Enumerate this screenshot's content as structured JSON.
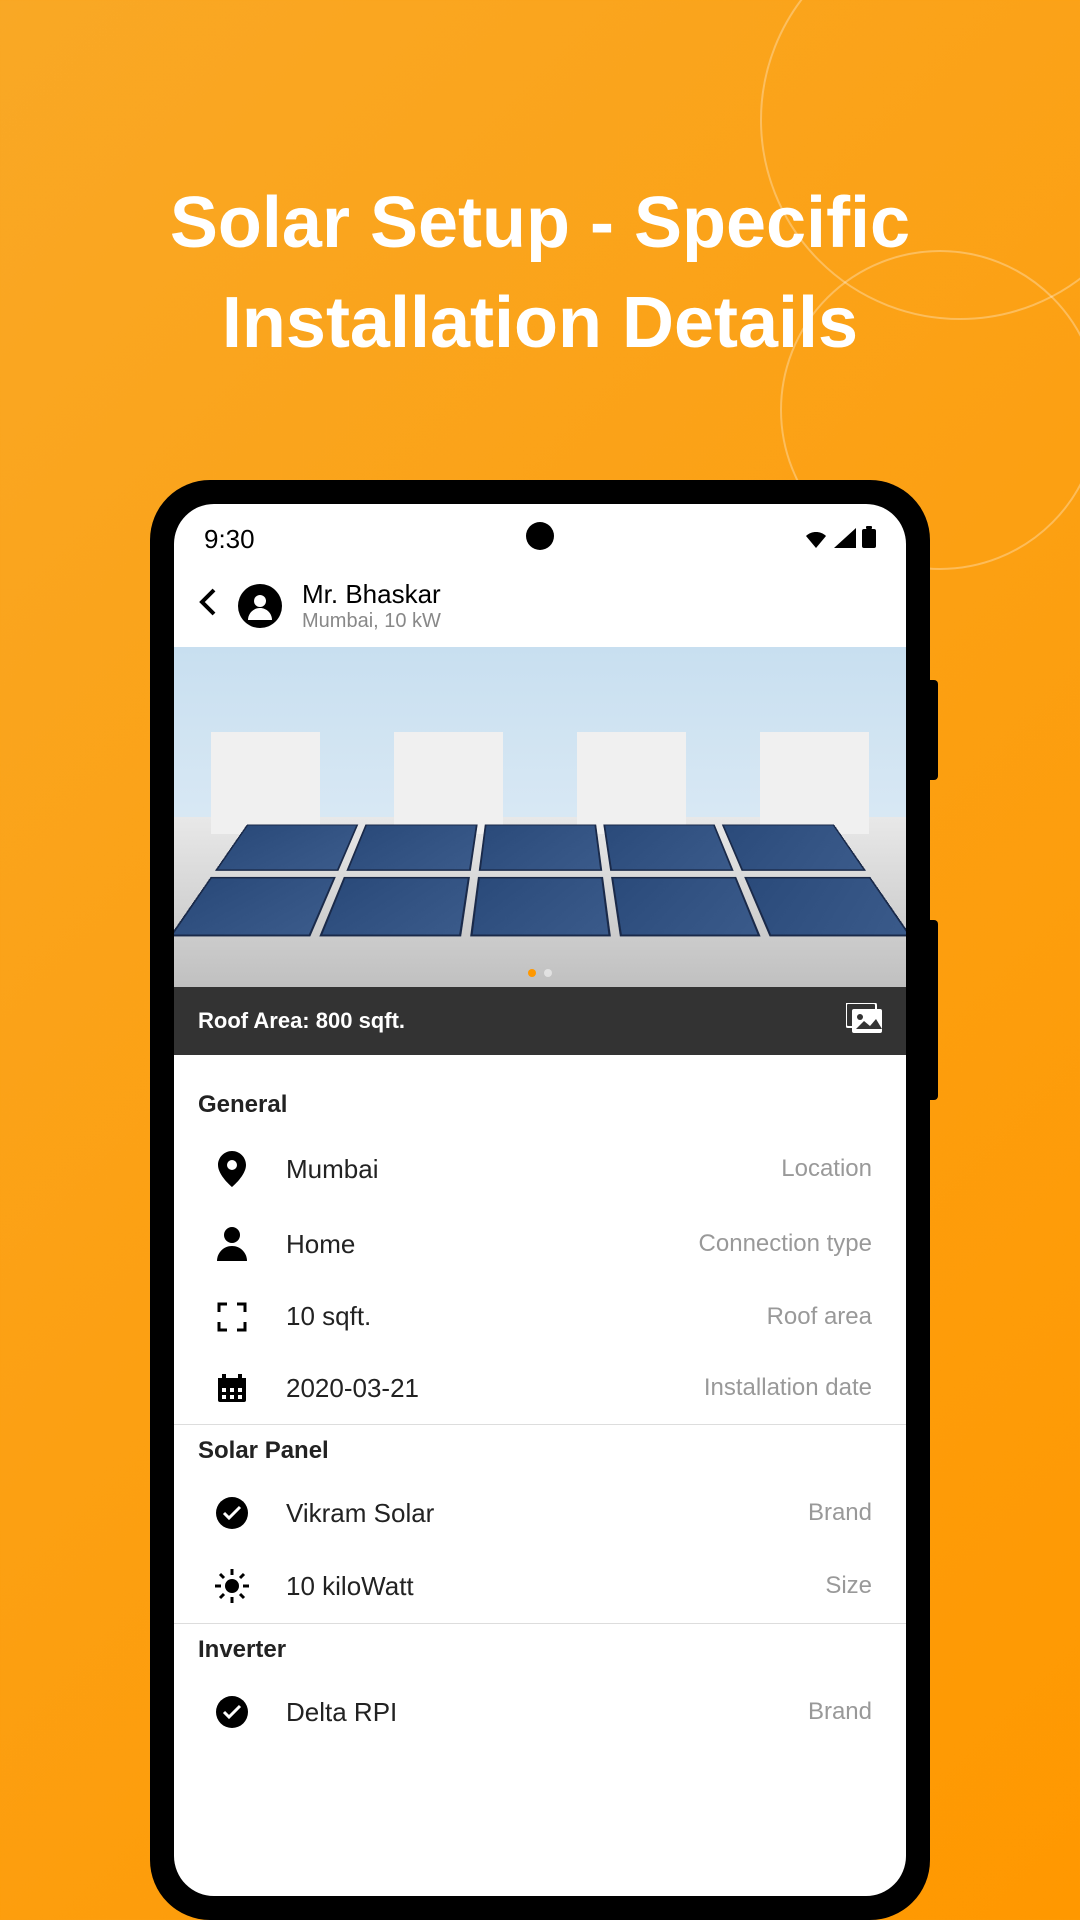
{
  "marketing": {
    "title_line1": "Solar Setup - Specific",
    "title_line2": "Installation Details"
  },
  "status_bar": {
    "time": "9:30"
  },
  "header": {
    "name": "Mr. Bhaskar",
    "subtitle": "Mumbai, 10 kW"
  },
  "info_strip": {
    "text": "Roof Area: 800 sqft."
  },
  "sections": {
    "general": {
      "title": "General",
      "rows": [
        {
          "value": "Mumbai",
          "label": "Location",
          "icon": "location"
        },
        {
          "value": "Home",
          "label": "Connection type",
          "icon": "person"
        },
        {
          "value": "10 sqft.",
          "label": "Roof area",
          "icon": "expand"
        },
        {
          "value": "2020-03-21",
          "label": "Installation date",
          "icon": "calendar"
        }
      ]
    },
    "solar_panel": {
      "title": "Solar Panel",
      "rows": [
        {
          "value": "Vikram Solar",
          "label": "Brand",
          "icon": "check"
        },
        {
          "value": "10 kiloWatt",
          "label": "Size",
          "icon": "sun"
        }
      ]
    },
    "inverter": {
      "title": "Inverter",
      "rows": [
        {
          "value": "Delta RPI",
          "label": "Brand",
          "icon": "check"
        }
      ]
    }
  }
}
